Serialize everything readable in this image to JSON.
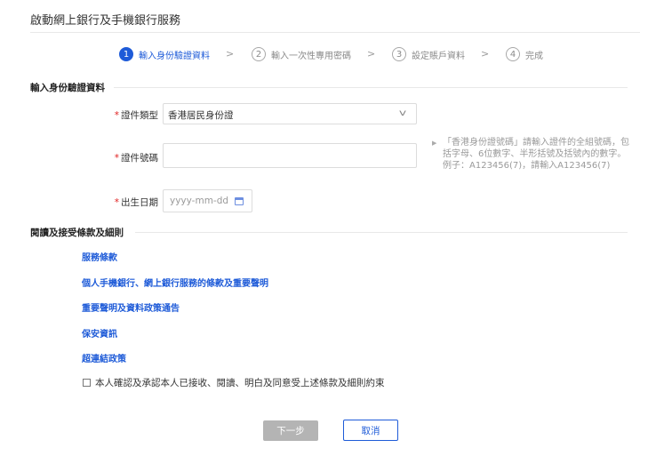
{
  "page": {
    "title": "啟動網上銀行及手機銀行服務"
  },
  "steps": [
    {
      "num": "1",
      "label": "輸入身份驗證資料",
      "active": true
    },
    {
      "num": "2",
      "label": "輸入一次性專用密碼",
      "active": false
    },
    {
      "num": "3",
      "label": "設定賬戶資料",
      "active": false
    },
    {
      "num": "4",
      "label": "完成",
      "active": false
    }
  ],
  "identity_section": {
    "heading": "輸入身份驗證資料",
    "required_mark": "*",
    "doc_type_label": "證件類型",
    "doc_type_value": "香港居民身份證",
    "doc_number_label": "證件號碼",
    "doc_number_value": "",
    "dob_label": "出生日期",
    "dob_placeholder": "yyyy-mm-dd",
    "hint_line1": "「香港身份證號碼」請輸入證件的全組號碼，包",
    "hint_line2": "括字母、6位數字、半形括號及括號內的數字。",
    "hint_line3": "例子：A123456(7)，請輸入A123456(7)"
  },
  "terms_section": {
    "heading": "閱讀及接受條款及細則",
    "links": [
      "服務條款",
      "個人手機銀行、網上銀行服務的條款及重要聲明",
      "重要聲明及資料政策通告",
      "保安資訊",
      "超連結政策"
    ],
    "confirm_text": "本人確認及承認本人已接收、閱讀、明白及同意受上述條款及細則約束",
    "confirm_checked": false
  },
  "buttons": {
    "next": "下一步",
    "cancel": "取消"
  },
  "colors": {
    "accent": "#1e5bd8",
    "required": "#e02020",
    "disabled_button": "#b4b4b4"
  }
}
